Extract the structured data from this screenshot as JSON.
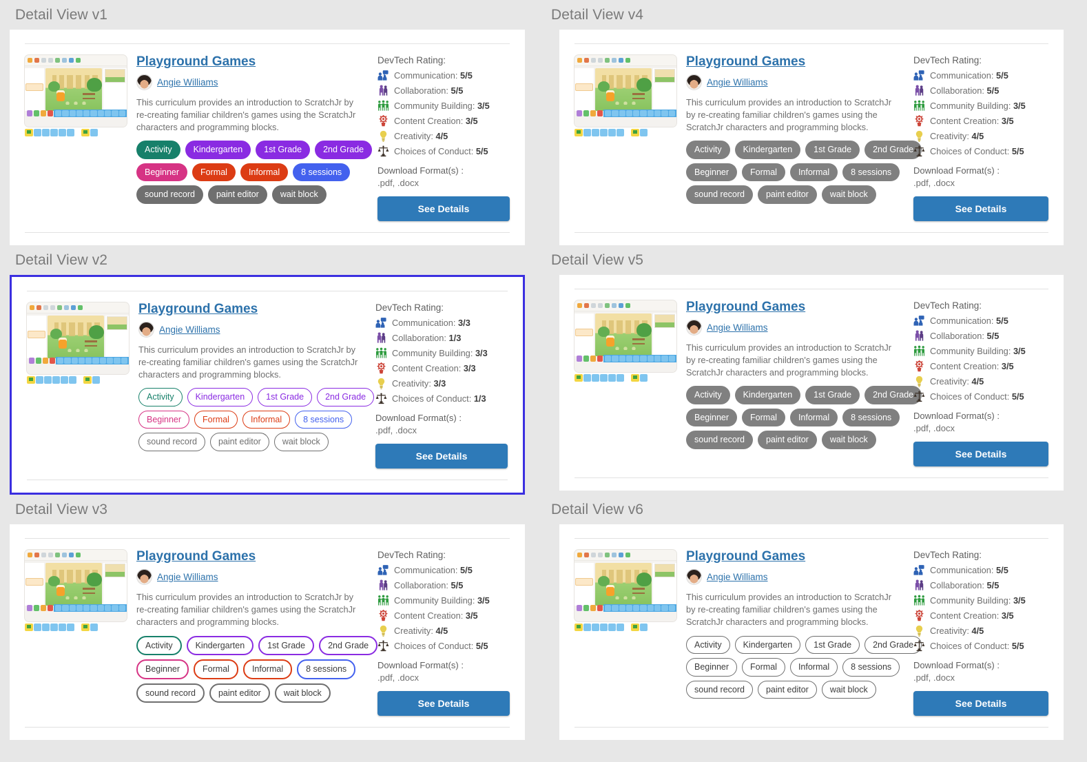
{
  "background_color": "#e7e7e7",
  "accent_blue": "#2d72ab",
  "button_color": "#2e7ab8",
  "selection_border_color": "#3b2fe0",
  "card": {
    "title": "Playground Games",
    "author": "Angie Williams",
    "description": "This curriculum provides an introduction to ScratchJr by re-creating familiar children's games using the ScratchJr characters and programming blocks.",
    "rating_header": "DevTech Rating:",
    "download_label": "Download Format(s) :",
    "download_formats": ".pdf, .docx",
    "button_label": "See Details",
    "thumbnail_alt": "scratchjr-editor-thumbnail"
  },
  "tag_rows": [
    [
      {
        "label": "Activity",
        "color": "#17806a"
      },
      {
        "label": "Kindergarten",
        "color": "#8a2be2"
      },
      {
        "label": "1st Grade",
        "color": "#8a2be2"
      },
      {
        "label": "2nd Grade",
        "color": "#8a2be2"
      }
    ],
    [
      {
        "label": "Beginner",
        "color": "#d63384"
      },
      {
        "label": "Formal",
        "color": "#dc3c14"
      },
      {
        "label": "Informal",
        "color": "#dc3c14"
      },
      {
        "label": "8 sessions",
        "color": "#4361ee"
      }
    ],
    [
      {
        "label": "sound record",
        "color": "#6f6f6f"
      },
      {
        "label": "paint editor",
        "color": "#6f6f6f"
      },
      {
        "label": "wait block",
        "color": "#6f6f6f"
      }
    ]
  ],
  "rating_icons": [
    {
      "name": "communication-icon",
      "color": "#2f63b5"
    },
    {
      "name": "collaboration-icon",
      "color": "#7b4fa8"
    },
    {
      "name": "community-building-icon",
      "color": "#2e9b3f"
    },
    {
      "name": "content-creation-icon",
      "color": "#cc4438"
    },
    {
      "name": "creativity-icon",
      "color": "#e8cf4e"
    },
    {
      "name": "choices-of-conduct-icon",
      "color": "#3a2f26"
    }
  ],
  "panels": [
    {
      "id": "v1",
      "section_title": "Detail View v1",
      "tag_style": "sty-filled",
      "selected": false,
      "ratings": [
        {
          "label": "Communication",
          "value": "5/5"
        },
        {
          "label": "Collaboration",
          "value": "5/5"
        },
        {
          "label": "Community Building",
          "value": "3/5"
        },
        {
          "label": "Content Creation",
          "value": "3/5"
        },
        {
          "label": "Creativity",
          "value": "4/5"
        },
        {
          "label": "Choices of Conduct",
          "value": "5/5"
        }
      ]
    },
    {
      "id": "v2",
      "section_title": "Detail View v2",
      "tag_style": "sty-outline-color",
      "selected": true,
      "ratings": [
        {
          "label": "Communication",
          "value": "3/3"
        },
        {
          "label": "Collaboration",
          "value": "1/3"
        },
        {
          "label": "Community Building",
          "value": "3/3"
        },
        {
          "label": "Content Creation",
          "value": "3/3"
        },
        {
          "label": "Creativity",
          "value": "3/3"
        },
        {
          "label": "Choices of Conduct",
          "value": "1/3"
        }
      ]
    },
    {
      "id": "v3",
      "section_title": "Detail View v3",
      "tag_style": "sty-outline-dark",
      "selected": false,
      "ratings": [
        {
          "label": "Communication",
          "value": "5/5"
        },
        {
          "label": "Collaboration",
          "value": "5/5"
        },
        {
          "label": "Community Building",
          "value": "3/5"
        },
        {
          "label": "Content Creation",
          "value": "3/5"
        },
        {
          "label": "Creativity",
          "value": "4/5"
        },
        {
          "label": "Choices of Conduct",
          "value": "5/5"
        }
      ]
    },
    {
      "id": "v4",
      "section_title": "Detail View v4",
      "tag_style": "sty-grey",
      "selected": false,
      "ratings": [
        {
          "label": "Communication",
          "value": "5/5"
        },
        {
          "label": "Collaboration",
          "value": "5/5"
        },
        {
          "label": "Community Building",
          "value": "3/5"
        },
        {
          "label": "Content Creation",
          "value": "3/5"
        },
        {
          "label": "Creativity",
          "value": "4/5"
        },
        {
          "label": "Choices of Conduct",
          "value": "5/5"
        }
      ]
    },
    {
      "id": "v5",
      "section_title": "Detail View v5",
      "tag_style": "sty-grey",
      "selected": false,
      "ratings": [
        {
          "label": "Communication",
          "value": "5/5"
        },
        {
          "label": "Collaboration",
          "value": "5/5"
        },
        {
          "label": "Community Building",
          "value": "3/5"
        },
        {
          "label": "Content Creation",
          "value": "3/5"
        },
        {
          "label": "Creativity",
          "value": "4/5"
        },
        {
          "label": "Choices of Conduct",
          "value": "5/5"
        }
      ]
    },
    {
      "id": "v6",
      "section_title": "Detail View v6",
      "tag_style": "sty-grey-outline",
      "selected": false,
      "ratings": [
        {
          "label": "Communication",
          "value": "5/5"
        },
        {
          "label": "Collaboration",
          "value": "5/5"
        },
        {
          "label": "Community Building",
          "value": "3/5"
        },
        {
          "label": "Content Creation",
          "value": "3/5"
        },
        {
          "label": "Creativity",
          "value": "4/5"
        },
        {
          "label": "Choices of Conduct",
          "value": "5/5"
        }
      ]
    }
  ]
}
